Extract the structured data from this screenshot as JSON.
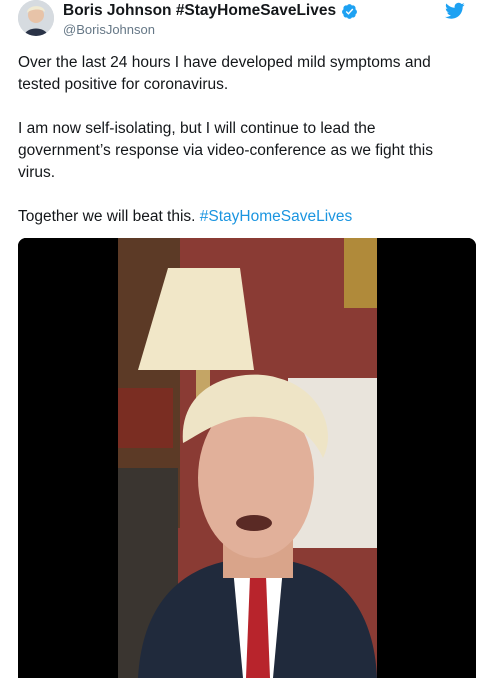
{
  "tweet": {
    "display_name": "Boris Johnson #StayHomeSaveLives",
    "handle": "@BorisJohnson",
    "paragraphs": [
      "Over the last 24 hours I have developed mild symptoms and tested positive for coronavirus.",
      "I am now self-isolating, but I will continue to lead the government’s response via video-conference as we fight this virus."
    ],
    "closing_text": "Together we will beat this.",
    "hashtag": "#StayHomeSaveLives"
  },
  "icons": {
    "verified": "verified-badge-icon",
    "brand": "twitter-bird-icon"
  },
  "colors": {
    "link": "#1b95e0",
    "verified": "#1da1f2",
    "handle": "#657786",
    "text": "#14171a"
  }
}
